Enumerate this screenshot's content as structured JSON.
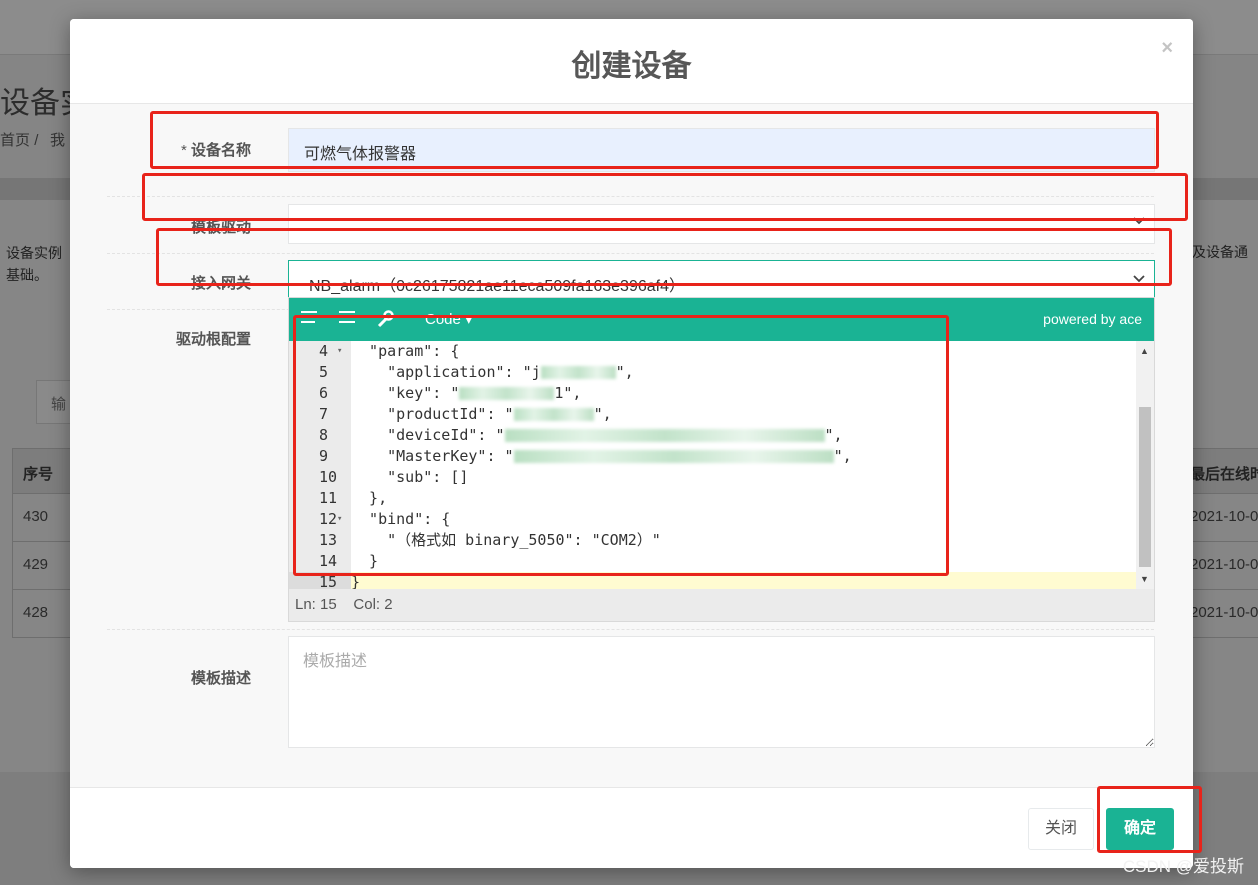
{
  "background": {
    "page_title": "设备实",
    "crumb_home": "首页",
    "crumb_sep": "/",
    "crumb_next": "我",
    "desc_line1": "设备实例",
    "desc_line2": "基础。",
    "desc_right": "及设备通",
    "search_placeholder": "输",
    "table": {
      "col_id": "序号",
      "col_last_online": "最后在线时",
      "rows": [
        {
          "id": "430",
          "last_online": "2021-10-0"
        },
        {
          "id": "429",
          "last_online": "2021-10-0"
        },
        {
          "id": "428",
          "last_online": "2021-10-0"
        }
      ]
    },
    "watermark": "CSDN @爱投斯"
  },
  "modal": {
    "title": "创建设备",
    "close_glyph": "×",
    "fields": {
      "name": {
        "required_mark": "* ",
        "label": "设备名称",
        "value": "可燃气体报警器"
      },
      "template": {
        "label": "模板驱动",
        "value": ""
      },
      "gateway": {
        "label": "接入网关",
        "value": "NB_alarm（0c26175821ae11eca509fa163e396af4）"
      },
      "config": {
        "label": "驱动根配置"
      },
      "description": {
        "label": "模板描述",
        "placeholder": "模板描述"
      }
    },
    "editor": {
      "mode_label": "Code ▾",
      "powered_by": "powered by ace",
      "lines": [
        {
          "n": "4",
          "fold": true,
          "text": "  \"param\": {"
        },
        {
          "n": "5",
          "text": "    \"application\": \"j",
          "redacted": true,
          "tail": "\","
        },
        {
          "n": "6",
          "text": "    \"key\": \"",
          "redacted": true,
          "tail": "1\","
        },
        {
          "n": "7",
          "text": "    \"productId\": \"",
          "redacted": true,
          "tail": "\","
        },
        {
          "n": "8",
          "text": "    \"deviceId\": \"",
          "redacted": true,
          "tail": "\","
        },
        {
          "n": "9",
          "text": "    \"MasterKey\": \"",
          "redacted": true,
          "tail": "\","
        },
        {
          "n": "10",
          "text": "    \"sub\": []"
        },
        {
          "n": "11",
          "text": "  },"
        },
        {
          "n": "12",
          "fold": true,
          "text": "  \"bind\": {"
        },
        {
          "n": "13",
          "text": "    \"（格式如 binary_5050\": \"COM2）\""
        },
        {
          "n": "14",
          "text": "  }"
        },
        {
          "n": "15",
          "text": "}"
        }
      ],
      "status": {
        "ln_label": "Ln:",
        "ln": "15",
        "col_label": "Col:",
        "col": "2"
      }
    },
    "buttons": {
      "close": "关闭",
      "confirm": "确定"
    }
  },
  "colors": {
    "accent": "#1ab394",
    "annotation": "#e8231a"
  }
}
